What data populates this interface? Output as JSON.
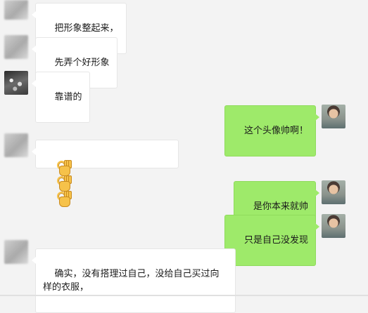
{
  "messages": [
    {
      "side": "in",
      "text": "把形象整起来，",
      "avatar": "blurred"
    },
    {
      "side": "in",
      "text": "先弄个好形象",
      "avatar": "blurred"
    },
    {
      "side": "in",
      "text": "靠谱的",
      "avatar": "bw-photo"
    },
    {
      "side": "out",
      "text": "这个头像帅啊！",
      "avatar": "me"
    },
    {
      "side": "in",
      "emoji": [
        "ok-hand-icon",
        "ok-hand-icon",
        "ok-hand-icon"
      ],
      "avatar": "blurred"
    },
    {
      "side": "out",
      "text": "是你本来就帅",
      "avatar": "me"
    },
    {
      "side": "out",
      "text": "只是自己没发现",
      "avatar": "me"
    },
    {
      "side": "in",
      "text": "确实，没有搭理过自己，没给自己买过向样的衣服，",
      "avatar": "blurred"
    }
  ],
  "colors": {
    "incoming_bubble": "#ffffff",
    "outgoing_bubble": "#9eea6a",
    "background": "#f3f3f3"
  }
}
